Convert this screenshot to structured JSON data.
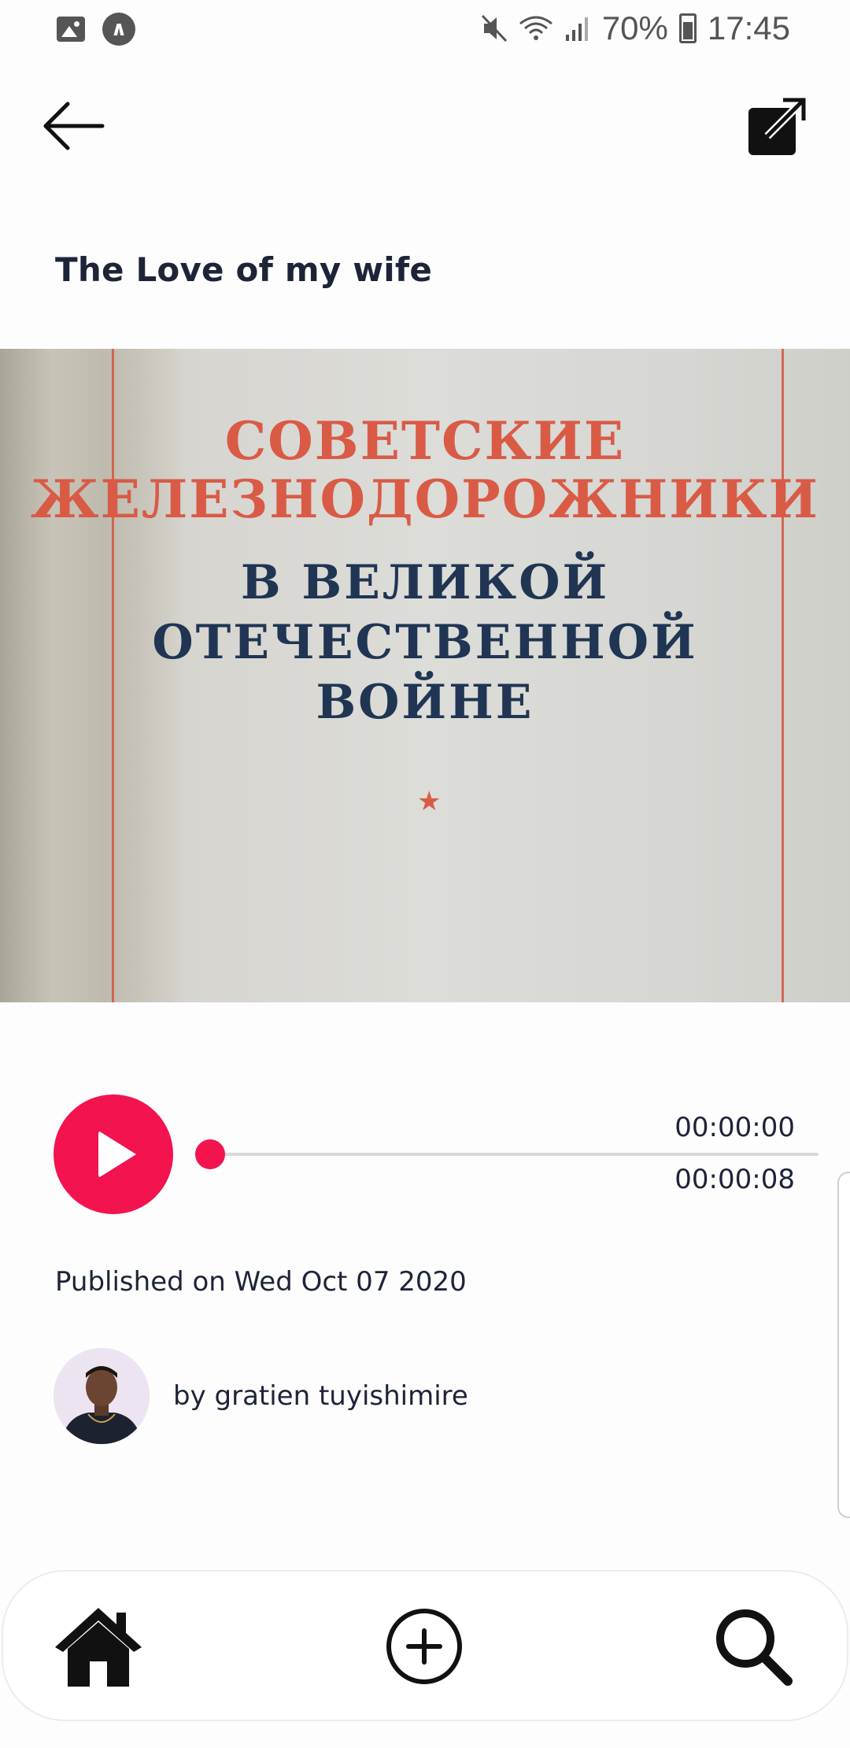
{
  "status_bar": {
    "left_icons": [
      "gallery-icon",
      "app-notification-icon"
    ],
    "battery": "70%",
    "time": "17:45",
    "right_icons": [
      "mute-icon",
      "wifi-icon",
      "signal-icon",
      "battery-icon"
    ]
  },
  "top_bar": {
    "back_icon": "arrow-left-icon",
    "open_icon": "open-external-icon"
  },
  "story": {
    "title": "The Love of my wife",
    "cover": {
      "line1": "СОВЕТСКИЕ",
      "line2": "ЖЕЛЕЗНОДОРОЖНИКИ",
      "line3": "В ВЕЛИКОЙ",
      "line4": "ОТЕЧЕСТВЕННОЙ",
      "line5": "ВОЙНЕ",
      "star": "★"
    },
    "published": "Published on Wed Oct 07 2020",
    "author": "by gratien tuyishimire"
  },
  "player": {
    "current_time": "00:00:00",
    "total_time": "00:00:08",
    "progress": 0,
    "accent": "#f2134f"
  },
  "bottom_nav": {
    "items": [
      {
        "icon": "home-icon"
      },
      {
        "icon": "add-circle-icon"
      },
      {
        "icon": "search-icon"
      }
    ]
  }
}
